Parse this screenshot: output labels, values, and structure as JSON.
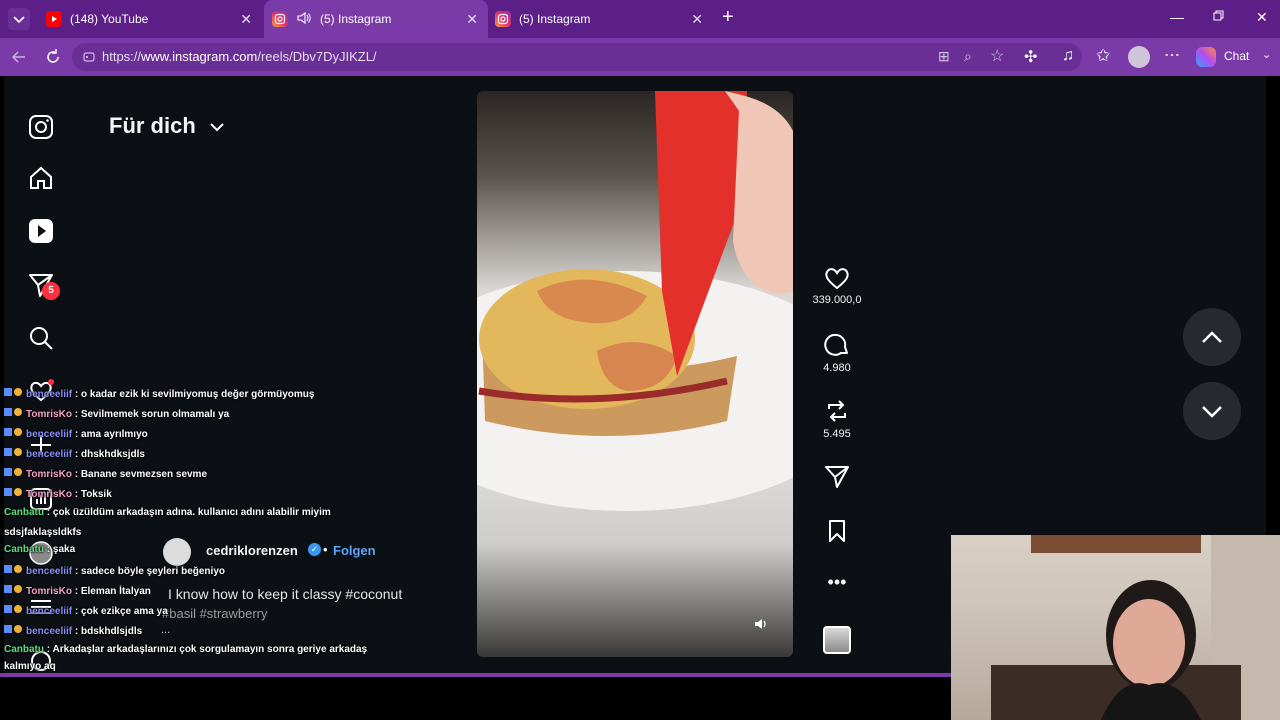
{
  "browser": {
    "tabs": [
      {
        "title": "(148) YouTube",
        "active": false,
        "icon": "youtube-icon"
      },
      {
        "title": "(5) Instagram",
        "active": true,
        "icon": "instagram-icon",
        "audio": true
      },
      {
        "title": "(5) Instagram",
        "active": false,
        "icon": "instagram-icon"
      }
    ],
    "url_prefix": "https://",
    "url_domain": "www.instagram.com",
    "url_path": "/reels/Dbv7DyJIKZL/",
    "chat_label": "Chat"
  },
  "feed": {
    "title": "Für dich",
    "notification_badge": "5"
  },
  "reel": {
    "likes": "339.000,0",
    "comments": "4.980",
    "reposts": "5.495",
    "author": "cedriklorenzen",
    "follow_label": "Folgen",
    "caption": "I know how to keep it classy #coconut",
    "caption_more": "#basil #strawberry",
    "more_dots": "..."
  },
  "chat": [
    {
      "user": "benceeliif",
      "msg": "o kadar ezik ki sevilmiyomuş değer görmüyomuş",
      "color": "blue",
      "badges": true
    },
    {
      "user": "TomrisKo",
      "msg": "Sevilmemek sorun olmamalı ya",
      "color": "pink",
      "badges": true
    },
    {
      "user": "benceeliif",
      "msg": "ama ayrılmıyo",
      "color": "blue",
      "badges": true
    },
    {
      "user": "benceeliif",
      "msg": "dhskhdksjdls",
      "color": "blue",
      "badges": true
    },
    {
      "user": "TomrisKo",
      "msg": "Banane sevmezsen sevme",
      "color": "pink",
      "badges": true
    },
    {
      "user": "TomrisKo",
      "msg": "Toksik",
      "color": "pink",
      "badges": true
    },
    {
      "user": "Canbatu",
      "msg": "çok üzüldüm arkadaşın adına. kullanıcı adını alabilir miyim",
      "color": "green",
      "badges": false
    },
    {
      "user": "",
      "msg": "sdsjfaklaşsldkfs",
      "color": "green",
      "badges": false
    },
    {
      "user": "Canbatu",
      "msg": "şaka",
      "color": "green",
      "badges": false
    },
    {
      "user": "benceeliif",
      "msg": "sadece böyle şeyleri beğeniyo",
      "color": "blue",
      "badges": true
    },
    {
      "user": "TomrisKo",
      "msg": "Eleman İtalyan",
      "color": "pink",
      "badges": true
    },
    {
      "user": "benceeliif",
      "msg": "çok ezikçe ama ya",
      "color": "blue",
      "badges": true
    },
    {
      "user": "benceeliif",
      "msg": "bdskhdlsjdls",
      "color": "blue",
      "badges": true
    },
    {
      "user": "Canbatu",
      "msg": "Arkadaşlar arkadaşlarınızı çok sorgulamayın sonra geriye arkadaş",
      "color": "green",
      "badges": false
    },
    {
      "user": "",
      "msg": "kalmıyo aq",
      "color": "green",
      "badges": false
    }
  ]
}
